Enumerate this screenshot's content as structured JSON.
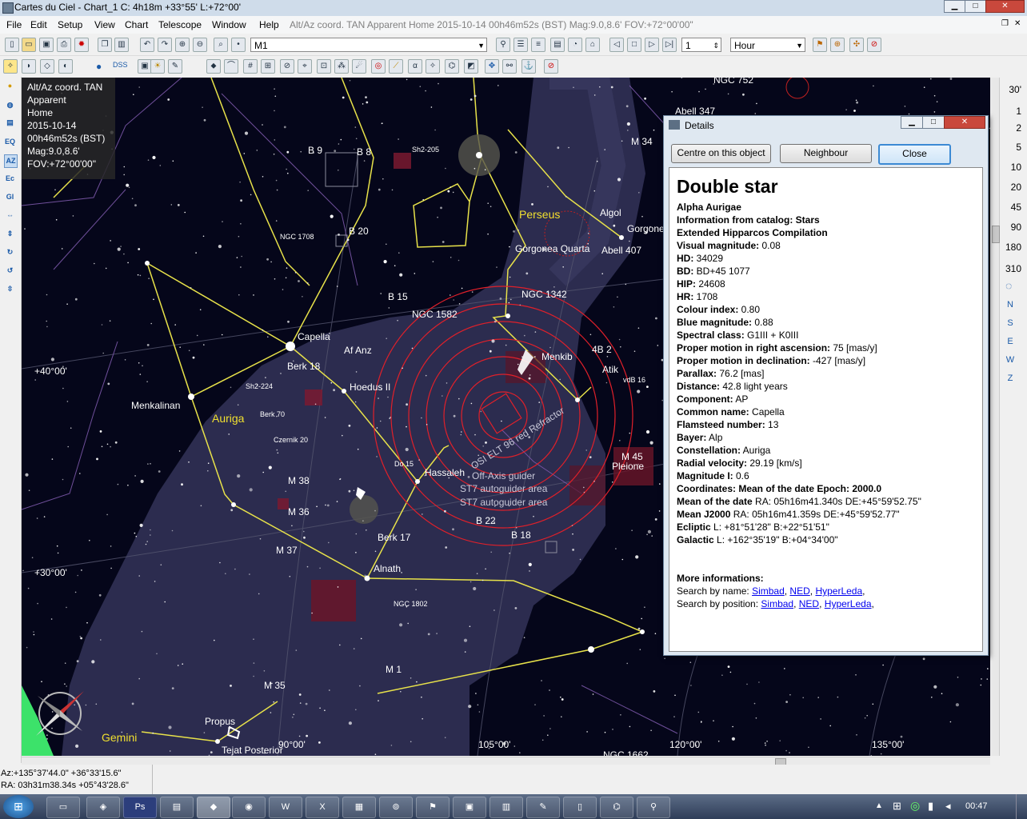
{
  "window": {
    "title": "Cartes du Ciel - Chart_1  C:  4h18m +33°55' L:+72°00'"
  },
  "menu": {
    "items": [
      "File",
      "Edit",
      "Setup",
      "View",
      "Chart",
      "Telescope",
      "Window",
      "Help"
    ],
    "status": "Alt/Az coord. TAN Apparent Home 2015-10-14 00h46m52s (BST) Mag:9.0,8.6' FOV:+72°00'00\""
  },
  "toolbar": {
    "search_value": "M1",
    "step_value": "1",
    "time_unit": "Hour",
    "dss_label": "DSS"
  },
  "overlay": {
    "lines": [
      "Alt/Az coord. TAN",
      "Apparent",
      "Home",
      "2015-10-14",
      "00h46m52s (BST)",
      "Mag:9.0,8.6'",
      "FOV:+72°00'00\""
    ]
  },
  "fov_scale": {
    "labels": [
      "30'",
      "1",
      "2",
      "5",
      "10",
      "20",
      "45",
      "90",
      "180",
      "310"
    ]
  },
  "directions": [
    "N",
    "S",
    "E",
    "W",
    "Z"
  ],
  "sky_labels": {
    "constellations": [
      "Auriga",
      "Perseus",
      "Gemini"
    ],
    "objects": [
      "Capella",
      "Menkalinan",
      "Hassaleh",
      "Alnath",
      "Algol",
      "Atik",
      "Menkib",
      "Pleione",
      "M 45",
      "M 38",
      "M 36",
      "M 37",
      "M 35",
      "M 34",
      "M 1",
      "NGC 1582",
      "NGC 1342",
      "NGC 1708",
      "NGC 1802",
      "NGC 752",
      "NGC 1662",
      "Berk 18",
      "Berk 17",
      "Berk 70",
      "Czernik 20",
      "Abell 347",
      "Abell 407",
      "Gorgonea Quarta",
      "Gorgone",
      "Propus",
      "Tejat Posterior",
      "B 8",
      "B 9",
      "B 15",
      "B 20",
      "B 22",
      "B 18",
      "4B 2",
      "Sh2-205",
      "Sh2-224",
      "Do 15",
      "Af Anz",
      "Hoedus II",
      "vdB 16"
    ],
    "fov_labels": [
      "OSI ELT 96 red Refractor",
      "Off-Axis guider",
      "ST7 autoguider area",
      "ST7 autoguider area"
    ],
    "grid_labels": [
      "+40°00'",
      "+30°00'",
      "90°00'",
      "105°00'",
      "120°00'",
      "135°00'"
    ]
  },
  "details": {
    "window_title": "Details",
    "buttons": {
      "centre": "Centre on this object",
      "neighbour": "Neighbour",
      "close": "Close"
    },
    "heading": "Double star",
    "lines": [
      {
        "k": "",
        "v": "Alpha Aurigae",
        "bold": true
      },
      {
        "k": "Information from catalog: Stars",
        "v": "",
        "bold": true
      },
      {
        "k": "Extended Hipparcos Compilation",
        "v": "",
        "bold": true
      },
      {
        "k": "Visual magnitude:",
        "v": " 0.08"
      },
      {
        "k": "HD:",
        "v": " 34029"
      },
      {
        "k": "BD:",
        "v": " BD+45 1077"
      },
      {
        "k": "HIP:",
        "v": " 24608"
      },
      {
        "k": "HR:",
        "v": " 1708"
      },
      {
        "k": "Colour index:",
        "v": " 0.80"
      },
      {
        "k": "Blue magnitude:",
        "v": " 0.88"
      },
      {
        "k": "Spectral class:",
        "v": " G1III + K0III"
      },
      {
        "k": "Proper motion in right ascension:",
        "v": " 75 [mas/y]"
      },
      {
        "k": "Proper motion in declination:",
        "v": " -427 [mas/y]"
      },
      {
        "k": "Parallax:",
        "v": " 76.2 [mas]"
      },
      {
        "k": "Distance:",
        "v": " 42.8 light years"
      },
      {
        "k": "Component:",
        "v": " AP"
      },
      {
        "k": "Common name:",
        "v": " Capella"
      },
      {
        "k": "Flamsteed number:",
        "v": " 13"
      },
      {
        "k": "Bayer:",
        "v": " Alp"
      },
      {
        "k": "Constellation:",
        "v": " Auriga"
      },
      {
        "k": "Radial velocity:",
        "v": " 29.19 [km/s]"
      },
      {
        "k": "Magnitude I:",
        "v": " 0.6"
      }
    ],
    "coords_title": "Coordinates: Mean of the date Epoch: 2000.0",
    "coords": [
      {
        "k": "Mean of the date",
        "v": " RA: 05h16m41.340s DE:+45°59'52.75\""
      },
      {
        "k": "Mean J2000",
        "v": " RA: 05h16m41.359s DE:+45°59'52.77\""
      },
      {
        "k": "Ecliptic",
        "v": "  L: +81°51'28\" B:+22°51'51\""
      },
      {
        "k": "Galactic",
        "v": "  L: +162°35'19\" B:+04°34'00\""
      }
    ],
    "more_title": "More informations:",
    "search_name_label": "Search by name: ",
    "search_pos_label": "Search by position: ",
    "links": [
      "Simbad",
      "NED",
      "HyperLeda"
    ]
  },
  "status": {
    "azalt": "Az:+135°37'44.0\" +36°33'15.6\"",
    "radec": "RA: 03h31m38.34s +05°43'28.6\""
  },
  "taskbar": {
    "clock": "00:47",
    "start": "⊞"
  }
}
